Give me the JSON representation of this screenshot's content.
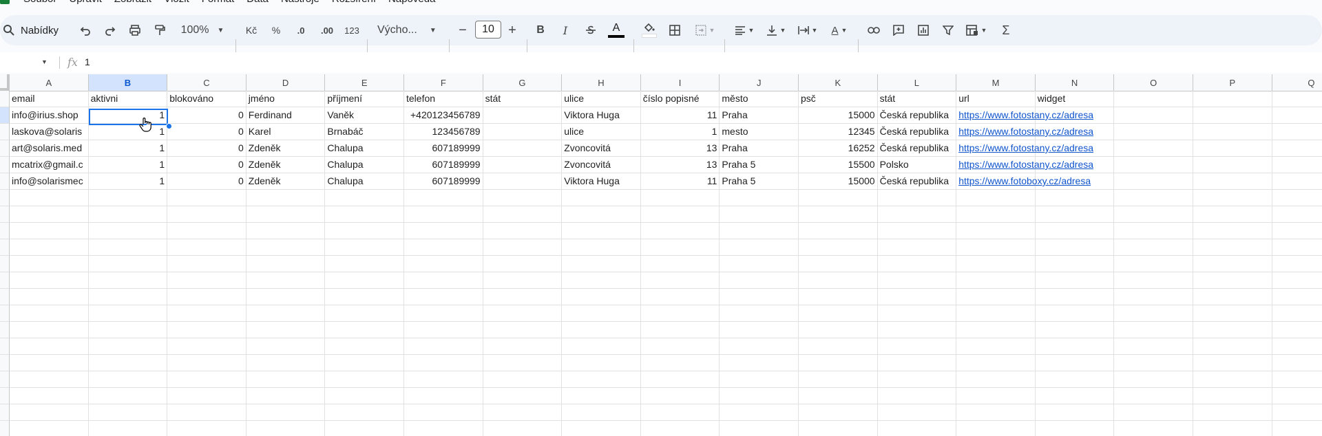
{
  "menu": [
    "Soubor",
    "Upravit",
    "Zobrazit",
    "Vložit",
    "Formát",
    "Data",
    "Nástroje",
    "Rozšíření",
    "Nápověda"
  ],
  "toolbar": {
    "search_label": "Nabídky",
    "zoom": "100%",
    "currency": "Kč",
    "percent": "%",
    "decrease_decimal": ".0",
    "increase_decimal": ".00",
    "number_format": "123",
    "font_name": "Výcho...",
    "font_size": "10",
    "minus": "−",
    "plus": "+",
    "bold": "B",
    "italic": "I",
    "sum": "Σ"
  },
  "formula_bar": {
    "fx": "fx",
    "value": "1"
  },
  "columns": [
    "A",
    "B",
    "C",
    "D",
    "E",
    "F",
    "G",
    "H",
    "I",
    "J",
    "K",
    "L",
    "M",
    "N",
    "O",
    "P",
    "Q"
  ],
  "selected_column": "B",
  "rows": [
    [
      "email",
      "aktivni",
      "blokováno",
      "jméno",
      "příjmení",
      "telefon",
      "stát",
      "ulice",
      "číslo popisné",
      "město",
      "psč",
      "stát",
      "url",
      "widget"
    ],
    [
      "info@irius.shop",
      "1",
      "0",
      "Ferdinand",
      "Vaněk",
      "+420123456789",
      "",
      "Viktora Huga",
      "11",
      "Praha",
      "15000",
      "Česká republika",
      "https://www.fotostany.cz/adresa",
      ""
    ],
    [
      "laskova@solaris",
      "1",
      "0",
      "Karel",
      "Brnabáč",
      "123456789",
      "",
      "ulice",
      "1",
      "mesto",
      "12345",
      "Česká republika",
      "https://www.fotostany.cz/adresa",
      ""
    ],
    [
      "art@solaris.med",
      "1",
      "0",
      "Zdeněk",
      "Chalupa",
      "607189999",
      "",
      "Zvoncovitá",
      "13",
      "Praha",
      "16252",
      "Česká republika",
      "https://www.fotostany.cz/adresa",
      ""
    ],
    [
      "mcatrix@gmail.c",
      "1",
      "0",
      "Zdeněk",
      "Chalupa",
      "607189999",
      "",
      "Zvoncovitá",
      "13",
      "Praha 5",
      "15500",
      "Polsko",
      "https://www.fotostany.cz/adresa",
      ""
    ],
    [
      "info@solarismec",
      "1",
      "0",
      "Zdeněk",
      "Chalupa",
      "607189999",
      "",
      "Viktora Huga",
      "11",
      "Praha 5",
      "15000",
      "Česká republika",
      "https://www.fotoboxy.cz/adresa",
      ""
    ]
  ]
}
